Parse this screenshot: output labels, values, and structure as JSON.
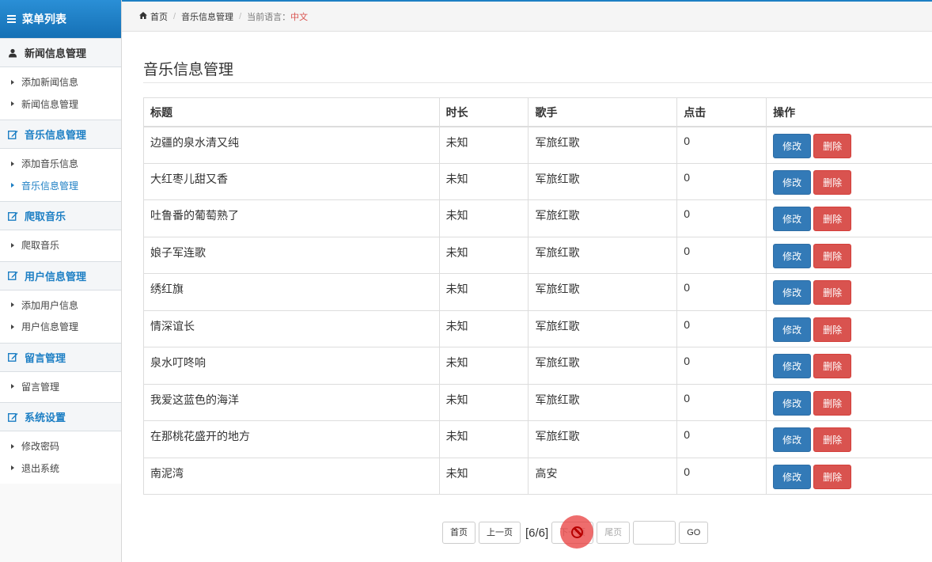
{
  "sidebar": {
    "header": "菜单列表",
    "groups": [
      {
        "title": "新闻信息管理",
        "icon": "user-icon",
        "items": [
          {
            "label": "添加新闻信息"
          },
          {
            "label": "新闻信息管理"
          }
        ]
      },
      {
        "title": "音乐信息管理",
        "icon": "edit-icon",
        "items": [
          {
            "label": "添加音乐信息"
          },
          {
            "label": "音乐信息管理"
          }
        ]
      },
      {
        "title": "爬取音乐",
        "icon": "edit-icon",
        "items": [
          {
            "label": "爬取音乐"
          }
        ]
      },
      {
        "title": "用户信息管理",
        "icon": "edit-icon",
        "items": [
          {
            "label": "添加用户信息"
          },
          {
            "label": "用户信息管理"
          }
        ]
      },
      {
        "title": "留言管理",
        "icon": "edit-icon",
        "items": [
          {
            "label": "留言管理"
          }
        ]
      },
      {
        "title": "系统设置",
        "icon": "edit-icon",
        "items": [
          {
            "label": "修改密码"
          },
          {
            "label": "退出系统"
          }
        ]
      }
    ]
  },
  "breadcrumb": {
    "home": "首页",
    "section": "音乐信息管理",
    "lang_label": "当前语言：",
    "lang_value": "中文"
  },
  "page": {
    "title": "音乐信息管理"
  },
  "table": {
    "headers": {
      "title": "标题",
      "duration": "时长",
      "singer": "歌手",
      "clicks": "点击",
      "ops": "操作"
    },
    "rows": [
      {
        "title": "边疆的泉水清又纯",
        "duration": "未知",
        "singer": "军旅红歌",
        "clicks": "0"
      },
      {
        "title": "大红枣儿甜又香",
        "duration": "未知",
        "singer": "军旅红歌",
        "clicks": "0"
      },
      {
        "title": "吐鲁番的葡萄熟了",
        "duration": "未知",
        "singer": "军旅红歌",
        "clicks": "0"
      },
      {
        "title": "娘子军连歌",
        "duration": "未知",
        "singer": "军旅红歌",
        "clicks": "0"
      },
      {
        "title": "绣红旗",
        "duration": "未知",
        "singer": "军旅红歌",
        "clicks": "0"
      },
      {
        "title": "情深谊长",
        "duration": "未知",
        "singer": "军旅红歌",
        "clicks": "0"
      },
      {
        "title": "泉水叮咚响",
        "duration": "未知",
        "singer": "军旅红歌",
        "clicks": "0"
      },
      {
        "title": "我爱这蓝色的海洋",
        "duration": "未知",
        "singer": "军旅红歌",
        "clicks": "0"
      },
      {
        "title": "在那桃花盛开的地方",
        "duration": "未知",
        "singer": "军旅红歌",
        "clicks": "0"
      },
      {
        "title": "南泥湾",
        "duration": "未知",
        "singer": "高安",
        "clicks": "0"
      }
    ],
    "edit_label": "修改",
    "delete_label": "删除"
  },
  "pager": {
    "first": "首页",
    "prev": "上一页",
    "info": "[6/6]",
    "next": "下一页",
    "last": "尾页",
    "go": "GO",
    "page_input_value": ""
  },
  "colors": {
    "primary": "#1d7fc4",
    "edit": "#337ab7",
    "danger": "#d9534f"
  }
}
